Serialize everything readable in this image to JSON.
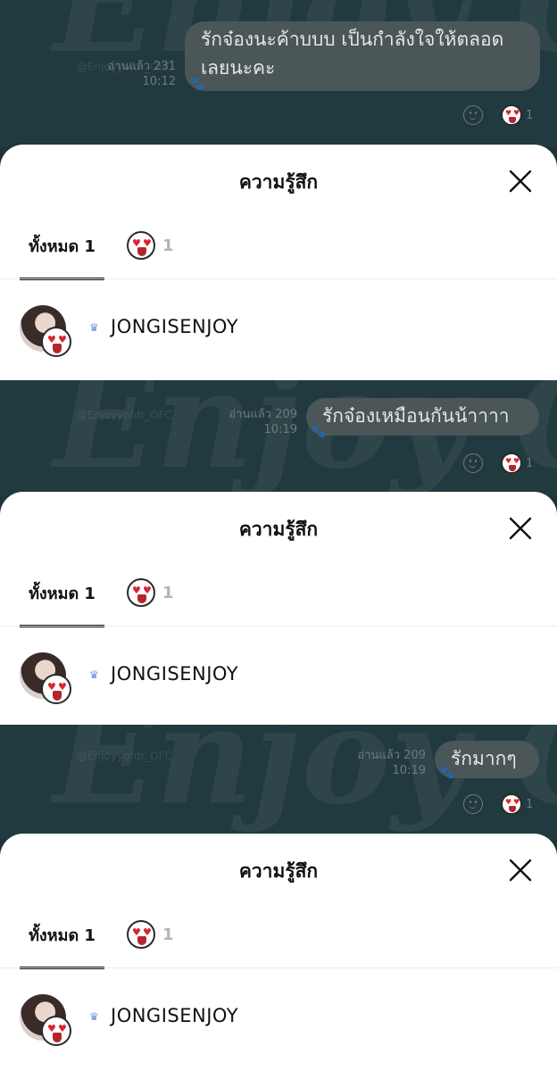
{
  "chats": [
    {
      "handle": "@Enjoyyofdr_OFC",
      "watermark": "Enjoy Olighi",
      "read_label": "อ่านแล้ว 231",
      "time": "10:12",
      "message": "รักจ๋องนะค้าบบบ เป็นกำลังใจให้ตลอดเลยนะคะ",
      "reaction_count": "1"
    },
    {
      "handle": "@Enjoyyofdr_OFC",
      "watermark": "Enjoy Olighi",
      "read_label": "อ่านแล้ว 209",
      "time": "10:19",
      "message": "รักจ๋องเหมือนกันน้าาาา",
      "reaction_count": "1"
    },
    {
      "handle": "@Enjoyyofdr_OFC",
      "watermark": "Enjoy Olighi",
      "read_label": "อ่านแล้ว 209",
      "time": "10:19",
      "message": "รักมากๆ",
      "reaction_count": "1"
    }
  ],
  "sheets": [
    {
      "title": "ความรู้สึก",
      "tab_all": "ทั้งหมด 1",
      "tab_emoji_count": "1",
      "user": "JONGISENJOY"
    },
    {
      "title": "ความรู้สึก",
      "tab_all": "ทั้งหมด 1",
      "tab_emoji_count": "1",
      "user": "JONGISENJOY"
    },
    {
      "title": "ความรู้สึก",
      "tab_all": "ทั้งหมด 1",
      "tab_emoji_count": "1",
      "user": "JONGISENJOY"
    }
  ],
  "icons": {
    "reaction": "heart-eyes-emoji-icon",
    "add_reaction": "smiley-icon",
    "close": "close-icon",
    "premium": "crown-icon"
  },
  "colors": {
    "heart": "#d8262f",
    "chat_bg": "#1f3438",
    "bubble": "#4b5658"
  }
}
